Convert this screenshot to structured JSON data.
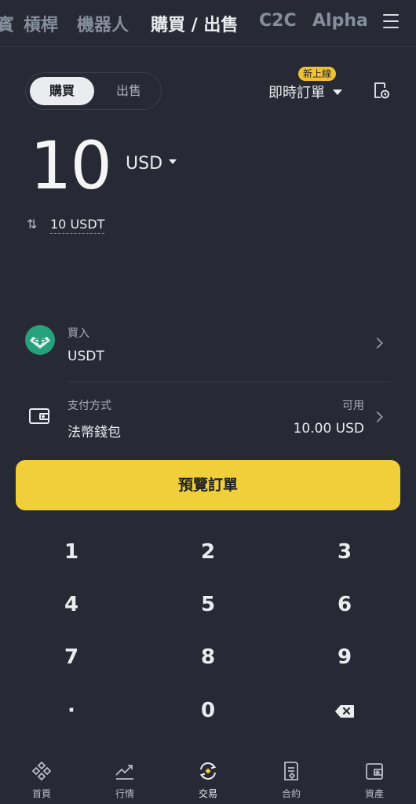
{
  "top_nav": {
    "tabs": [
      {
        "label": "賓"
      },
      {
        "label": "槓桿"
      },
      {
        "label": "機器人"
      },
      {
        "label": "購買 / 出售",
        "active": true
      },
      {
        "label": "C2C"
      },
      {
        "label": "Alpha"
      }
    ],
    "menu_icon": "hamburger-icon"
  },
  "trade_toggle": {
    "buy": "購買",
    "sell": "出售",
    "selected": "buy"
  },
  "order_type": {
    "label": "即時訂單",
    "badge": "新上線"
  },
  "amount": {
    "value": "10",
    "currency": "USD",
    "converted": "10 USDT"
  },
  "buy_asset": {
    "label": "買入",
    "asset": "USDT",
    "icon": "tether-icon"
  },
  "payment": {
    "label": "支付方式",
    "method": "法幣錢包",
    "available_label": "可用",
    "available_value": "10.00 USD",
    "icon": "wallet-icon"
  },
  "preview_button": "預覽訂單",
  "keypad": {
    "keys": [
      "1",
      "2",
      "3",
      "4",
      "5",
      "6",
      "7",
      "8",
      "9",
      "·",
      "0"
    ],
    "backspace_icon": "backspace-icon"
  },
  "bottom_nav": [
    {
      "label": "首頁",
      "icon": "home-icon"
    },
    {
      "label": "行情",
      "icon": "markets-icon"
    },
    {
      "label": "交易",
      "icon": "trade-icon",
      "active": true
    },
    {
      "label": "合約",
      "icon": "futures-icon"
    },
    {
      "label": "資產",
      "icon": "assets-icon"
    }
  ],
  "colors": {
    "background": "#272a34",
    "accent": "#f0cf3a",
    "tether": "#26a17b"
  }
}
